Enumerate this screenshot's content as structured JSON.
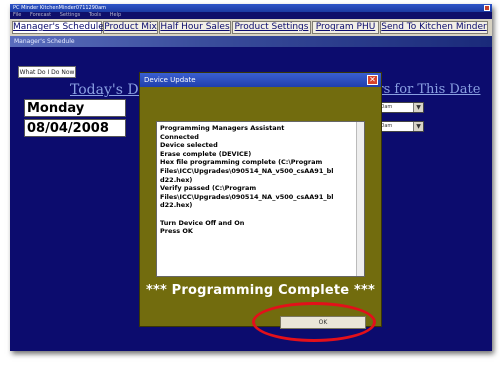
{
  "window": {
    "title": "PC Minder  KitchenMinder0711290am",
    "menu": [
      "File",
      "Forecast",
      "Settings",
      "Tools",
      "Help"
    ]
  },
  "tabs": [
    {
      "label": "Manager's Schedule",
      "active": true
    },
    {
      "label": "Product Mix",
      "active": false
    },
    {
      "label": "Half Hour Sales",
      "active": false
    },
    {
      "label": "Product Settings",
      "active": false
    },
    {
      "label": "Program PHU",
      "active": false
    },
    {
      "label": "Send To Kitchen Minder",
      "active": false
    }
  ],
  "section_title": "Manager's Schedule",
  "what_do_button": "What Do I Do Now",
  "today": {
    "label": "Today's Date",
    "day": "Monday",
    "date": "08/04/2008"
  },
  "hours": {
    "label": "urs for This Date",
    "selects": [
      "00am",
      "00am"
    ]
  },
  "dialog": {
    "title": "Device Update",
    "close_symbol": "✕",
    "log_lines": [
      "Programming Managers Assistant",
      "Connected",
      "Device selected",
      "Erase complete (DEVICE)",
      "Hex file programming complete (C:\\Program Files\\ICC\\Upgrades\\090514_NA_v500_csAA91_bl d22.hex)",
      "Verify passed (C:\\Program Files\\ICC\\Upgrades\\090514_NA_v500_csAA91_bl d22.hex)",
      "",
      "Turn Device Off and On",
      "Press OK"
    ],
    "status": "*** Programming Complete ***",
    "ok_label": "OK"
  },
  "colors": {
    "window_bg": "#0c0c6e",
    "dialog_bg": "#726c0e",
    "highlight": "#e3101a"
  }
}
